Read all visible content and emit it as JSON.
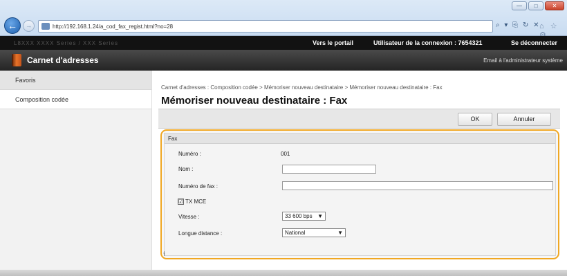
{
  "browser": {
    "url": "http://192.168.1.24/a_cod_fax_regist.html?no=28",
    "addr_tools": "⌕ ▾ ⎘ ↻ ✕",
    "tab_icons": "⌂ ☆ ⚙",
    "window_buttons": [
      "—",
      "□",
      "✕"
    ]
  },
  "topbar": {
    "device": "L8XXX  XXXX Series / XXX Series",
    "portal_link": "Vers le portail",
    "user_label": "Utilisateur de la connexion : 7654321",
    "logout_link": "Se déconnecter"
  },
  "header": {
    "title": "Carnet d'adresses",
    "email_link": "Email à l'administrateur système"
  },
  "sidebar": {
    "items": [
      {
        "label": "Favoris"
      },
      {
        "label": "Composition codée"
      }
    ]
  },
  "main": {
    "breadcrumb": "Carnet d'adresses : Composition codée > Mémoriser nouveau destinataire > Mémoriser nouveau destinataire : Fax",
    "page_title": "Mémoriser nouveau destinataire : Fax",
    "ok_label": "OK",
    "cancel_label": "Annuler",
    "collapse_icon": "⫮"
  },
  "form": {
    "section_title": "Fax",
    "numero_label": "Numéro :",
    "numero_value": "001",
    "nom_label": "Nom :",
    "nom_value": "",
    "fax_label": "Numéro de fax :",
    "fax_value": "",
    "txmce_label": "TX MCE",
    "txmce_checked": "☑",
    "vitesse_label": "Vitesse :",
    "vitesse_value": "33 600 bps",
    "distance_label": "Longue distance :",
    "distance_value": "National"
  }
}
